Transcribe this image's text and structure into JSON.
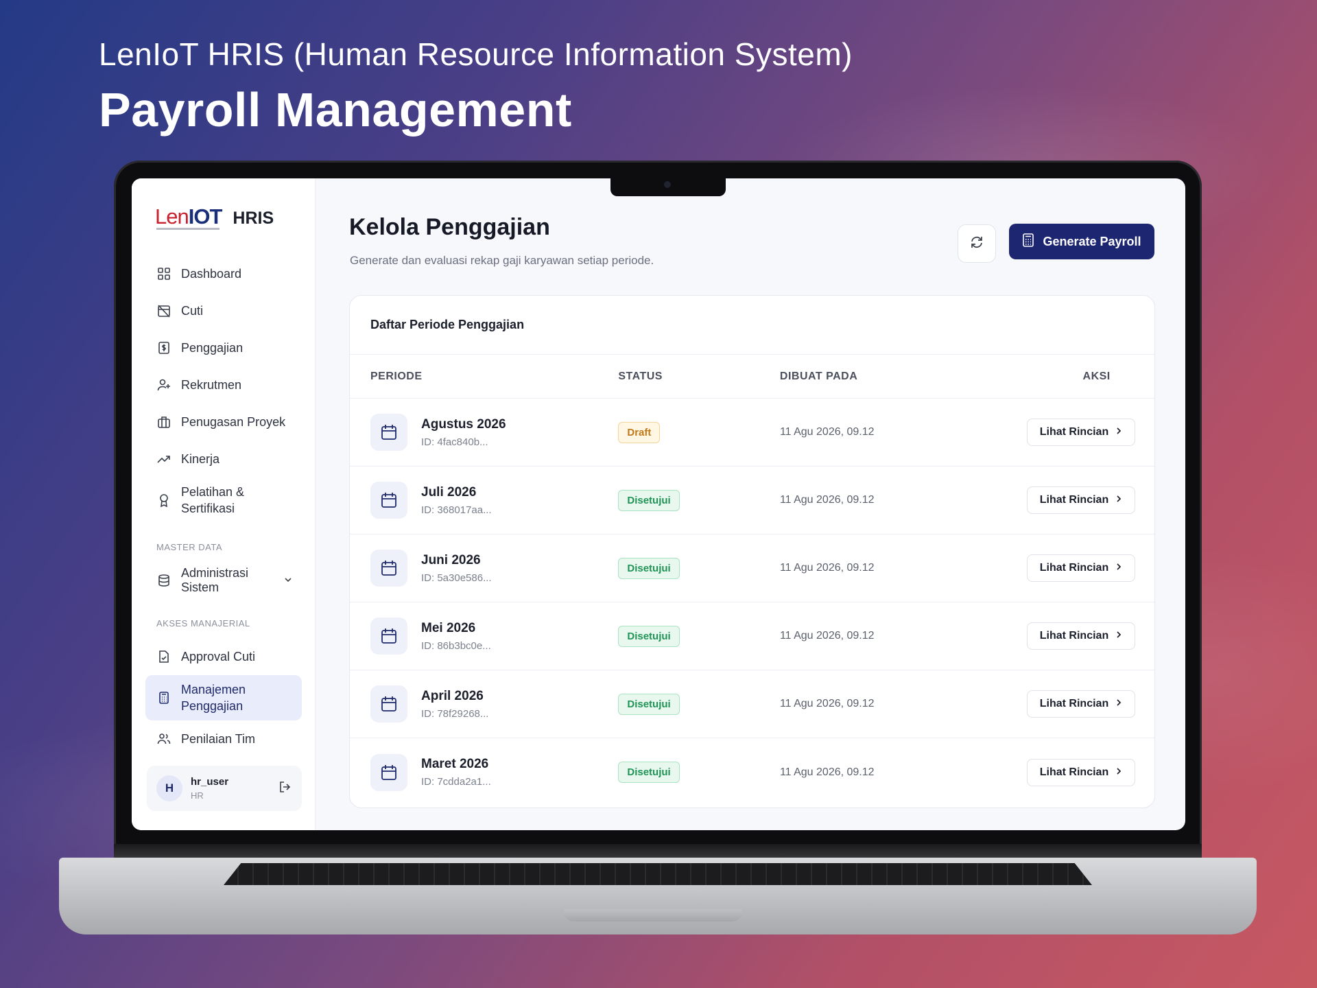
{
  "headline": {
    "eyebrow": "LenIoT HRIS (Human Resource Information System)",
    "title": "Payroll Management"
  },
  "sidebar": {
    "logo": {
      "brand_a": "Len",
      "brand_b": "IOT",
      "product": "HRIS"
    },
    "items": [
      {
        "label": "Dashboard",
        "icon": "dashboard-grid-icon"
      },
      {
        "label": "Cuti",
        "icon": "calendar-off-icon"
      },
      {
        "label": "Penggajian",
        "icon": "dollar-file-icon"
      },
      {
        "label": "Rekrutmen",
        "icon": "user-plus-icon"
      },
      {
        "label": "Penugasan Proyek",
        "icon": "briefcase-icon"
      },
      {
        "label": "Kinerja",
        "icon": "trend-up-icon"
      },
      {
        "label": "Pelatihan & Sertifikasi",
        "icon": "award-icon"
      }
    ],
    "section_master": "MASTER DATA",
    "admin_item": {
      "label": "Administrasi Sistem",
      "icon": "database-icon"
    },
    "section_manager": "AKSES MANAJERIAL",
    "manager_items": [
      {
        "label": "Approval Cuti",
        "icon": "file-check-icon"
      },
      {
        "label": "Manajemen Penggajian",
        "icon": "calculator-icon",
        "active": true
      },
      {
        "label": "Penilaian Tim",
        "icon": "users-icon"
      }
    ],
    "user": {
      "initial": "H",
      "name": "hr_user",
      "role": "HR"
    }
  },
  "main": {
    "title": "Kelola Penggajian",
    "subtitle": "Generate dan evaluasi rekap gaji karyawan setiap periode.",
    "generate_label": "Generate Payroll",
    "card_title": "Daftar Periode Penggajian",
    "columns": [
      "PERIODE",
      "STATUS",
      "DIBUAT PADA",
      "AKSI"
    ],
    "detail_label": "Lihat Rincian",
    "rows": [
      {
        "period": "Agustus 2026",
        "id": "ID: 4fac840b...",
        "status": "Draft",
        "created": "11 Agu 2026, 09.12"
      },
      {
        "period": "Juli 2026",
        "id": "ID: 368017aa...",
        "status": "Disetujui",
        "created": "11 Agu 2026, 09.12"
      },
      {
        "period": "Juni 2026",
        "id": "ID: 5a30e586...",
        "status": "Disetujui",
        "created": "11 Agu 2026, 09.12"
      },
      {
        "period": "Mei 2026",
        "id": "ID: 86b3bc0e...",
        "status": "Disetujui",
        "created": "11 Agu 2026, 09.12"
      },
      {
        "period": "April 2026",
        "id": "ID: 78f29268...",
        "status": "Disetujui",
        "created": "11 Agu 2026, 09.12"
      },
      {
        "period": "Maret 2026",
        "id": "ID: 7cdda2a1...",
        "status": "Disetujui",
        "created": "11 Agu 2026, 09.12"
      }
    ]
  },
  "colors": {
    "accent": "#1d2670",
    "draft": "#c0791a",
    "approved": "#1f9455",
    "active_bg": "#e9ecfb"
  }
}
